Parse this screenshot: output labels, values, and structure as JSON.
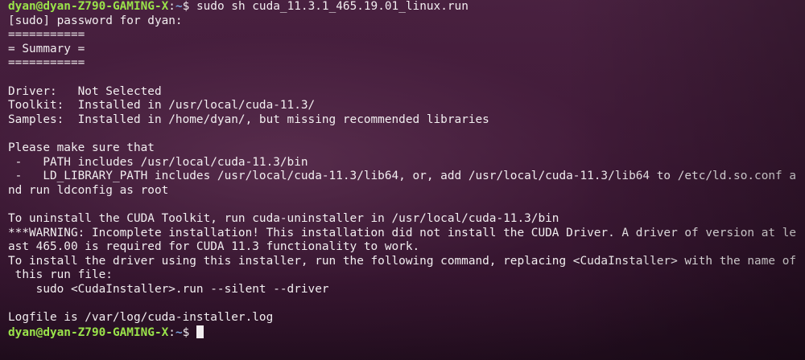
{
  "prompt": {
    "user_host": "dyan@dyan-Z790-GAMING-X",
    "colon": ":",
    "path": "~",
    "symbol": "$"
  },
  "command": " sudo sh cuda_11.3.1_465.19.01_linux.run",
  "output_lines": [
    "[sudo] password for dyan:",
    "===========",
    "= Summary =",
    "===========",
    "",
    "Driver:   Not Selected",
    "Toolkit:  Installed in /usr/local/cuda-11.3/",
    "Samples:  Installed in /home/dyan/, but missing recommended libraries",
    "",
    "Please make sure that",
    " -   PATH includes /usr/local/cuda-11.3/bin",
    " -   LD_LIBRARY_PATH includes /usr/local/cuda-11.3/lib64, or, add /usr/local/cuda-11.3/lib64 to /etc/ld.so.conf a",
    "nd run ldconfig as root",
    "",
    "To uninstall the CUDA Toolkit, run cuda-uninstaller in /usr/local/cuda-11.3/bin",
    "***WARNING: Incomplete installation! This installation did not install the CUDA Driver. A driver of version at le",
    "ast 465.00 is required for CUDA 11.3 functionality to work.",
    "To install the driver using this installer, run the following command, replacing <CudaInstaller> with the name of",
    " this run file:",
    "    sudo <CudaInstaller>.run --silent --driver",
    "",
    "Logfile is /var/log/cuda-installer.log"
  ],
  "colors": {
    "prompt_user": "#9ae34a",
    "prompt_path": "#7aa7e0",
    "text": "#f2eef0",
    "background": "#3d1a36"
  }
}
